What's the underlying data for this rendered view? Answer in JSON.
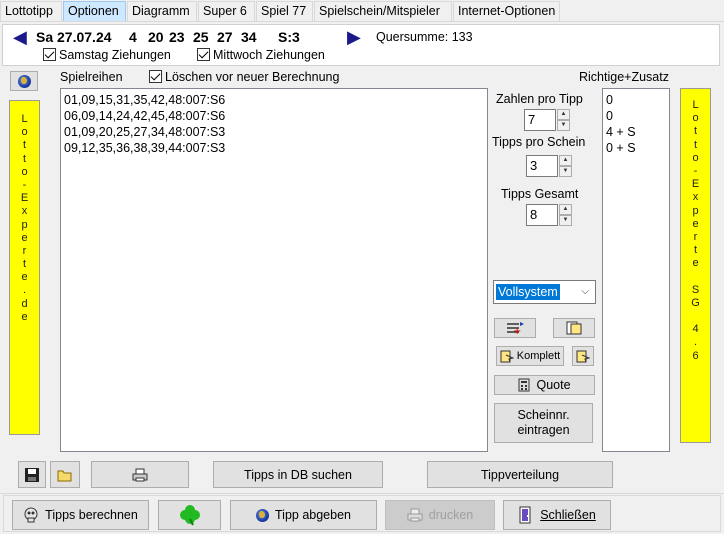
{
  "tabs": [
    "Lottotipp",
    "Optionen",
    "Diagramm",
    "Super 6",
    "Spiel 77",
    "Spielschein/Mitspieler",
    "Internet-Optionen"
  ],
  "header": {
    "date": "Sa 27.07.24",
    "numbers": [
      "4",
      "20",
      "23",
      "25",
      "27",
      "34"
    ],
    "superzahl": "S:3",
    "quersumme": "Quersumme: 133",
    "saturday_label": "Samstag Ziehungen",
    "wednesday_label": "Mittwoch Ziehungen"
  },
  "left_banner": [
    "L",
    "o",
    "t",
    "t",
    "o",
    "-",
    "E",
    "x",
    "p",
    "e",
    "r",
    "t",
    "e",
    ".",
    "d",
    "e"
  ],
  "right_banner": [
    "L",
    "o",
    "t",
    "t",
    "o",
    "-",
    "E",
    "x",
    "p",
    "e",
    "r",
    "t",
    "e",
    "",
    "S",
    "G",
    "",
    "4",
    ".",
    "6"
  ],
  "spielreihen": {
    "label": "Spielreihen",
    "clear_label": "Löschen vor neuer Berechnung",
    "rows": [
      "01,09,15,31,35,42,48:007:S6",
      "06,09,14,24,42,45,48:007:S6",
      "01,09,20,25,27,34,48:007:S3",
      "09,12,35,36,38,39,44:007:S3"
    ]
  },
  "richtige": {
    "label": "Richtige+Zusatz",
    "rows": [
      "0",
      "0",
      "4 + S",
      "0 + S"
    ]
  },
  "controls": {
    "zahlen_label": "Zahlen pro Tipp",
    "zahlen_value": "7",
    "tipps_schein_label": "Tipps pro Schein",
    "tipps_schein_value": "3",
    "tipps_gesamt_label": "Tipps Gesamt",
    "tipps_gesamt_value": "8",
    "system_value": "Vollsystem",
    "komplett_label": "Komplett",
    "quote_label": "Quote",
    "scheinnr_label_1": "Scheinnr.",
    "scheinnr_label_2": "eintragen"
  },
  "toolbar": {
    "db_search_label": "Tipps in DB suchen",
    "tippverteilung_label": "Tippverteilung"
  },
  "bottom": {
    "berechnen_label": "Tipps berechnen",
    "abgeben_label": "Tipp abgeben",
    "drucken_label": "drucken",
    "schliessen_label": "Schließen"
  }
}
